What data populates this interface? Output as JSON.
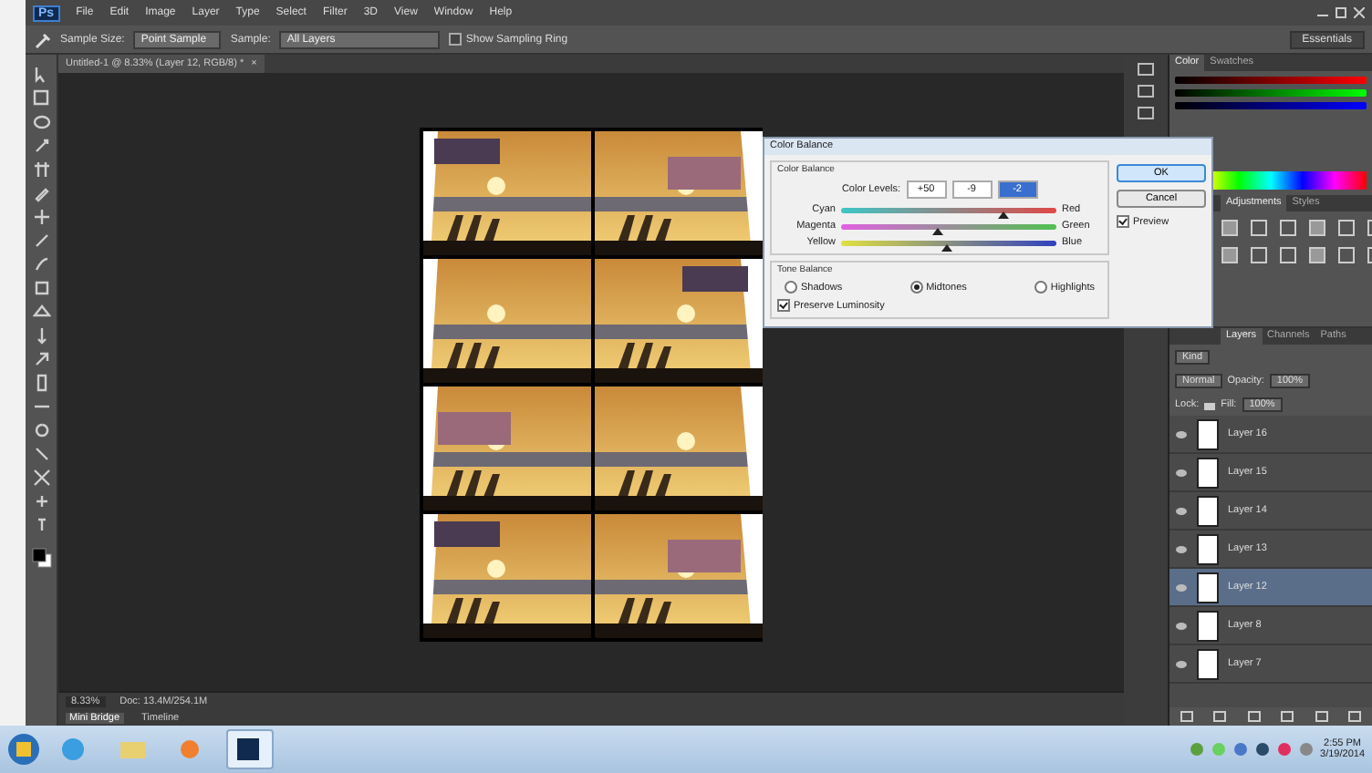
{
  "app": {
    "logo": "Ps",
    "menu": [
      "File",
      "Edit",
      "Image",
      "Layer",
      "Type",
      "Select",
      "Filter",
      "3D",
      "View",
      "Window",
      "Help"
    ]
  },
  "options_bar": {
    "sample_size_label": "Sample Size:",
    "sample_size": "Point Sample",
    "sample_label": "Sample:",
    "sample": "All Layers",
    "show_ring": {
      "label": "Show Sampling Ring",
      "checked": false
    }
  },
  "workspace": "Essentials",
  "document": {
    "tab": "Untitled-1 @ 8.33% (Layer 12, RGB/8) *",
    "close": "×",
    "zoom": "8.33%",
    "doc_info": "Doc: 13.4M/254.1M"
  },
  "bottom_tabs": [
    {
      "label": "Mini Bridge",
      "selected": true
    },
    {
      "label": "Timeline",
      "selected": false
    }
  ],
  "dialog": {
    "title": "Color Balance",
    "group": "Color Balance",
    "levels_label": "Color Levels:",
    "levels": [
      "+50",
      "-9",
      "-2"
    ],
    "sliders": [
      {
        "left": "Cyan",
        "right": "Red",
        "level": 0.75
      },
      {
        "left": "Magenta",
        "right": "Green",
        "level": 0.45
      },
      {
        "left": "Yellow",
        "right": "Blue",
        "level": 0.49
      }
    ],
    "tone_group": "Tone Balance",
    "tone_balance": [
      {
        "label": "Shadows",
        "selected": false
      },
      {
        "label": "Midtones",
        "selected": true
      },
      {
        "label": "Highlights",
        "selected": false
      }
    ],
    "preserve_luminosity": {
      "label": "Preserve Luminosity",
      "checked": true
    },
    "ok": "OK",
    "cancel": "Cancel",
    "preview": {
      "label": "Preview",
      "checked": true
    }
  },
  "color_panel": {
    "tabs": [
      {
        "label": "Color",
        "selected": true
      },
      {
        "label": "Swatches",
        "selected": false
      }
    ]
  },
  "adjustments_panel": {
    "tabs": [
      {
        "label": "Adjustments",
        "selected": true
      },
      {
        "label": "Styles",
        "selected": false
      }
    ]
  },
  "layers_panel": {
    "tabs": [
      {
        "label": "Layers",
        "selected": true
      },
      {
        "label": "Channels",
        "selected": false
      },
      {
        "label": "Paths",
        "selected": false
      }
    ],
    "kind": "Kind",
    "blend": "Normal",
    "opacity_label": "Opacity:",
    "opacity": "100%",
    "lock_label": "Lock:",
    "fill_label": "Fill:",
    "fill": "100%",
    "rows": [
      {
        "name": "Layer 16",
        "selected": false
      },
      {
        "name": "Layer 15",
        "selected": false
      },
      {
        "name": "Layer 14",
        "selected": false
      },
      {
        "name": "Layer 13",
        "selected": false
      },
      {
        "name": "Layer 12",
        "selected": true
      },
      {
        "name": "Layer 8",
        "selected": false
      },
      {
        "name": "Layer 7",
        "selected": false
      }
    ]
  },
  "taskbar": {
    "apps": [
      {
        "kind": "browser",
        "selected": false
      },
      {
        "kind": "folder",
        "selected": false
      },
      {
        "kind": "media",
        "selected": false
      },
      {
        "kind": "photoshop",
        "selected": true
      }
    ],
    "time": "2:55 PM",
    "date": "3/19/2014"
  }
}
